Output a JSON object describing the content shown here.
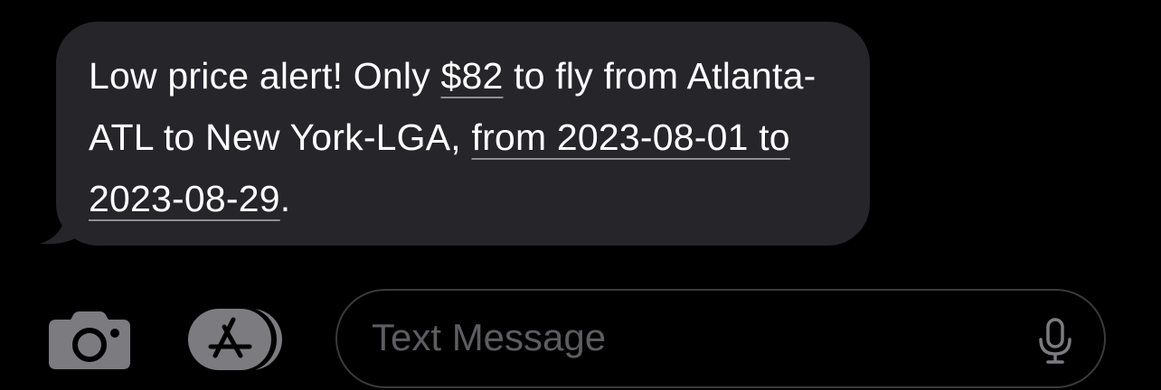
{
  "message": {
    "part1": "Low price alert! Only ",
    "price_link": "$82",
    "part2": " to fly from Atlanta-ATL to New York-LGA, ",
    "date_link": "from 2023-08-01 to 2023-08-29",
    "part3": "."
  },
  "composer": {
    "placeholder": "Text Message",
    "icons": [
      "camera-icon",
      "app-store-icon",
      "microphone-icon"
    ]
  },
  "colors": {
    "bubble": "#26252a",
    "icon_gray": "#7c7c80",
    "input_border": "#3a3a3c"
  }
}
